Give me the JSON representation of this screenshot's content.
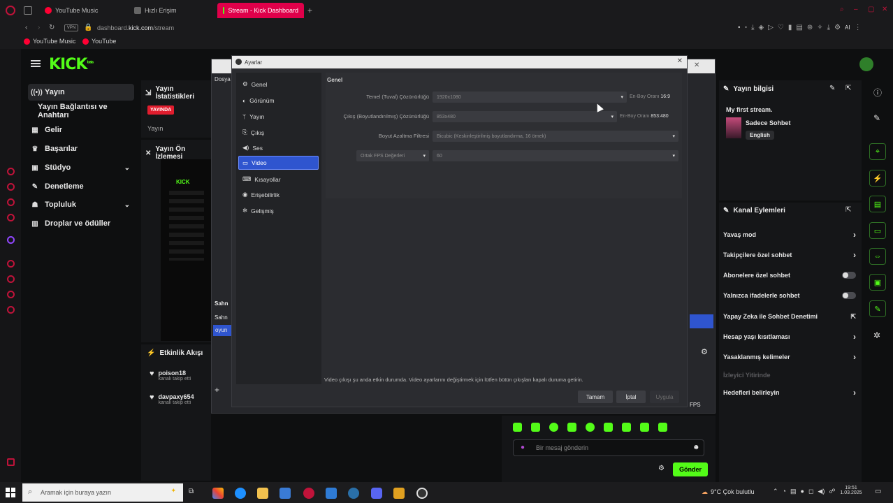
{
  "browser": {
    "tabs": [
      {
        "label": "YouTube Music",
        "color": "#ff0033"
      },
      {
        "label": "Hızlı Erişim",
        "color": "#666666"
      },
      {
        "label": "Stream - Kick Dashboard",
        "color": "#53fc18"
      }
    ],
    "url_host": "dashboard.",
    "url_domain": "kick.com",
    "url_path": "/stream",
    "bookmarks": [
      "YouTube Music",
      "YouTube"
    ],
    "ai_label": "AI"
  },
  "kick": {
    "logo": "KICK",
    "logo_badge": "beta",
    "nav": [
      {
        "label": "Yayın",
        "icon": "(•)"
      },
      {
        "label": "Yayın Bağlantısı ve Anahtarı",
        "icon": ""
      },
      {
        "label": "Gelir",
        "icon": "▦"
      },
      {
        "label": "Başarılar",
        "icon": "🏆"
      },
      {
        "label": "Stüdyo",
        "icon": "▣"
      },
      {
        "label": "Denetleme",
        "icon": "🔧"
      },
      {
        "label": "Topluluk",
        "icon": "👥"
      },
      {
        "label": "Droplar ve ödüller",
        "icon": "🎁"
      }
    ],
    "stats": {
      "title": "Yayın İstatistikleri",
      "live_badge": "YAYINDA",
      "sub": "Yayın"
    },
    "preview_title": "Yayın Ön İzlemesi",
    "activity": {
      "title": "Etkinlik Akışı",
      "items": [
        {
          "user": "poison18",
          "action": "kanalı takip etti"
        },
        {
          "user": "davpaxy654",
          "action": "kanalı takip etti"
        }
      ]
    },
    "obs_fragments": {
      "menu": "Dosya",
      "scenes_header": "Sahn",
      "scene_item": "Sahn",
      "source_item": "oyun",
      "fps": "FPS"
    },
    "stream_info": {
      "title": "Yayın bilgisi",
      "stream_title": "My first stream.",
      "category": "Sadece Sohbet",
      "language": "English"
    },
    "channel_actions": {
      "title": "Kanal Eylemleri",
      "items": [
        {
          "label": "Yavaş mod",
          "control": "arrow"
        },
        {
          "label": "Takipçilere özel sohbet",
          "control": "arrow"
        },
        {
          "label": "Abonelere özel sohbet",
          "control": "toggle"
        },
        {
          "label": "Yalnızca ifadelerle sohbet",
          "control": "toggle"
        },
        {
          "label": "Yapay Zeka ile Sohbet Denetimi",
          "control": "external"
        },
        {
          "label": "Hesap yaşı kısıtlaması",
          "control": "arrow"
        },
        {
          "label": "Yasaklanmış kelimeler",
          "control": "arrow"
        },
        {
          "label": "İzleyici Yitirinde",
          "control": "none"
        },
        {
          "label": "Hedefleri belirleyin",
          "control": "arrow"
        }
      ]
    },
    "chat": {
      "placeholder": "Bir mesaj gönderin",
      "send": "Gönder"
    }
  },
  "settings": {
    "title": "Ayarlar",
    "sidebar": [
      {
        "label": "Genel",
        "icon": "⚙"
      },
      {
        "label": "Görünüm",
        "icon": "◐"
      },
      {
        "label": "Yayın",
        "icon": "📶"
      },
      {
        "label": "Çıkış",
        "icon": "⎘"
      },
      {
        "label": "Ses",
        "icon": "🔊"
      },
      {
        "label": "Video",
        "icon": "▭"
      },
      {
        "label": "Kısayollar",
        "icon": "⌨"
      },
      {
        "label": "Erişebilirlik",
        "icon": "◉"
      },
      {
        "label": "Gelişmiş",
        "icon": "✲"
      }
    ],
    "section": "Genel",
    "base_res_label": "Temel (Tuval) Çözünürlüğü",
    "base_res_value": "1920x1080",
    "base_aspect_label": "En-Boy Oranı",
    "base_aspect_value": "16:9",
    "out_res_label": "Çıkış (Boyutlandırılmış) Çözünürlüğü",
    "out_res_value": "853x480",
    "out_aspect_label": "En-Boy Oranı",
    "out_aspect_value": "853:480",
    "filter_label": "Boyut Azaltma Filtresi",
    "filter_value": "Bicubic (Keskinleştirilmiş boyutlandırma, 16 örnek)",
    "fps_label": "Ortak FPS Değerleri",
    "fps_value": "60",
    "notice": "Video çıkışı şu anda etkin durumda. Video ayarlarını değiştirmek için lütfen bütün çıkışları kapalı duruma getirin.",
    "buttons": {
      "ok": "Tamam",
      "cancel": "İptal",
      "apply": "Uygula"
    }
  },
  "taskbar": {
    "search_placeholder": "Aramak için buraya yazın",
    "weather": "9°C  Çok bulutlu",
    "time": "19:51",
    "date": "1.03.2025"
  },
  "colors": {
    "accent": "#53fc18",
    "live": "#e11d2e",
    "selected": "#2f55cf",
    "brand_pink": "#e0004a"
  }
}
